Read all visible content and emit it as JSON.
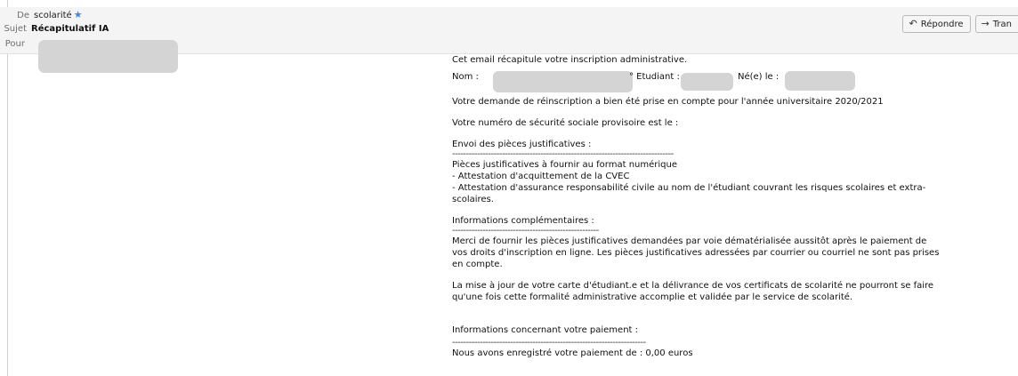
{
  "header": {
    "from_label": "De",
    "from_value": "scolarité",
    "subject_label": "Sujet",
    "subject_value": "Récapitulatif IA",
    "to_label": "Pour"
  },
  "actions": {
    "reply_label": "Répondre",
    "forward_label": "Tran"
  },
  "body": {
    "intro": "Cet email récapitule votre inscription administrative.",
    "nom_label": "Nom :",
    "etudiant_label": "° Etudiant :",
    "nee_label": "Né(e) le :",
    "reinscription": "Votre demande de réinscription a bien été prise en compte pour l'année universitaire 2020/2021",
    "secu": "Votre numéro de sécurité sociale provisoire est le :",
    "envoi_title": "Envoi des pièces justificatives :",
    "envoi_dashes": "--------------------------------------------------------------------------------",
    "pieces_intro": "Pièces justificatives à fournir au format numérique",
    "pieces_item1": "- Attestation d'acquittement de la CVEC",
    "pieces_item2": "- Attestation d'assurance responsabilité civile au nom de l'étudiant couvrant les risques scolaires et extra-",
    "pieces_item2b": "scolaires.",
    "infos_title": "Informations complémentaires :",
    "infos_dashes": "-----------------------------------------------------",
    "infos_p1a": "Merci de fournir les pièces justificatives demandées par voie dématérialisée aussitôt après le paiement de",
    "infos_p1b": "vos droits d'inscription en ligne. Les pièces justificatives adressées par courrier ou courriel ne sont pas prises",
    "infos_p1c": "en compte.",
    "infos_p2a": "La mise à jour de votre carte d'étudiant.e et la délivrance de vos certificats de scolarité ne pourront se faire",
    "infos_p2b": "qu'une fois cette formalité administrative accomplie et validée par le service de scolarité.",
    "paiement_title": "Informations concernant votre paiement :",
    "paiement_dashes": "----------------------------------------------------------------------",
    "paiement_value": "Nous avons enregistré votre paiement de : 0,00 euros"
  },
  "icons": {
    "star": "star-icon",
    "reply": "reply-icon",
    "forward": "forward-icon"
  },
  "colors": {
    "accent_star": "#3b87e5",
    "header_bg": "#f4f4f4",
    "redaction": "#d4d4d4"
  }
}
